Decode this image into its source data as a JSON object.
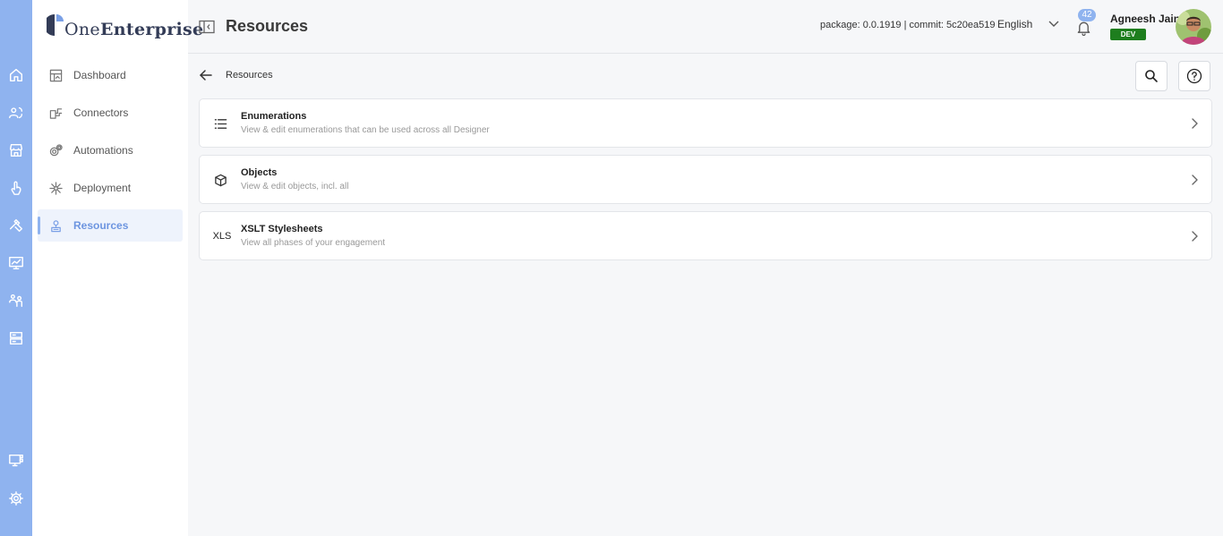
{
  "app": {
    "logo_prefix": "One",
    "logo_suffix": "Enterprise"
  },
  "rail": {
    "top_icons": [
      "home-icon",
      "users-sync-icon",
      "store-icon",
      "touch-icon",
      "tools-icon",
      "monitor-chart-icon",
      "people-icon",
      "server-icon"
    ],
    "bottom_icons": [
      "monitor-grid-icon",
      "gear-icon"
    ]
  },
  "sidebar": {
    "items": [
      {
        "label": "Dashboard",
        "icon": "dashboard-icon"
      },
      {
        "label": "Connectors",
        "icon": "connector-icon"
      },
      {
        "label": "Automations",
        "icon": "automation-icon"
      },
      {
        "label": "Deployment",
        "icon": "deployment-icon"
      },
      {
        "label": "Resources",
        "icon": "resources-icon",
        "active": true
      }
    ]
  },
  "header": {
    "title": "Resources",
    "build_info": "package: 0.0.1919 | commit: 5c20ea519",
    "language": "English",
    "notification_count": "42",
    "user_name": "Agneesh Jain",
    "env_badge": "DEV"
  },
  "breadcrumb": {
    "label": "Resources"
  },
  "cards": [
    {
      "title": "Enumerations",
      "description": "View & edit enumerations that can be used across all Designer",
      "icon": "list-icon"
    },
    {
      "title": "Objects",
      "description": "View & edit objects, incl. all",
      "icon": "cube-icon"
    },
    {
      "title": "XSLT Stylesheets",
      "description": "View all phases of your engagement",
      "icon_text": "XLS"
    }
  ],
  "colors": {
    "accent": "#8fb3ef",
    "active_text": "#6d95e0",
    "env_badge": "#1e7e1e"
  }
}
